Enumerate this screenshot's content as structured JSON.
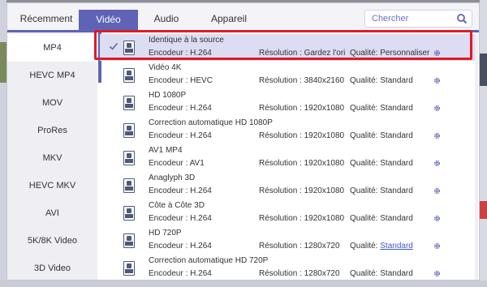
{
  "tabs": [
    {
      "label": "Récemment",
      "active": false
    },
    {
      "label": "Vidéo",
      "active": true
    },
    {
      "label": "Audio",
      "active": false
    },
    {
      "label": "Appareil",
      "active": false
    }
  ],
  "search": {
    "placeholder": "Chercher",
    "value": ""
  },
  "sidebar": {
    "items": [
      {
        "label": "MP4",
        "active": true
      },
      {
        "label": "HEVC MP4",
        "active": false
      },
      {
        "label": "MOV",
        "active": false
      },
      {
        "label": "ProRes",
        "active": false
      },
      {
        "label": "MKV",
        "active": false
      },
      {
        "label": "HEVC MKV",
        "active": false
      },
      {
        "label": "AVI",
        "active": false
      },
      {
        "label": "5K/8K Video",
        "active": false
      },
      {
        "label": "3D Video",
        "active": false
      }
    ]
  },
  "formats": [
    {
      "name": "Identique à la source",
      "encoder": "Encodeur : H.264",
      "resolution": "Résolution : Gardez l'original",
      "quality": "Qualité: Personnaliser",
      "quality_link": false,
      "selected": true,
      "icon": "file-copy-icon"
    },
    {
      "name": "Vidéo 4K",
      "encoder": "Encodeur : HEVC",
      "resolution": "Résolution : 3840x2160",
      "quality": "Qualité: Standard",
      "quality_link": false,
      "selected": false,
      "icon": "4k-icon"
    },
    {
      "name": "HD 1080P",
      "encoder": "Encodeur : H.264",
      "resolution": "Résolution : 1920x1080",
      "quality": "Qualité: Standard",
      "quality_link": false,
      "selected": false,
      "icon": "1080p-icon"
    },
    {
      "name": "Correction automatique HD 1080P",
      "encoder": "Encodeur : H.264",
      "resolution": "Résolution : 1920x1080",
      "quality": "Qualité: Standard",
      "quality_link": false,
      "selected": false,
      "icon": "1080p-icon"
    },
    {
      "name": "AV1 MP4",
      "encoder": "Encodeur : AV1",
      "resolution": "Résolution : 1920x1080",
      "quality": "Qualité: Standard",
      "quality_link": false,
      "selected": false,
      "icon": "av1-icon"
    },
    {
      "name": "Anaglyph 3D",
      "encoder": "Encodeur : H.264",
      "resolution": "Résolution : 1920x1080",
      "quality": "Qualité: Standard",
      "quality_link": false,
      "selected": false,
      "icon": "3d-icon"
    },
    {
      "name": "Côte à Côte 3D",
      "encoder": "Encodeur : H.264",
      "resolution": "Résolution : 1920x1080",
      "quality": "Qualité: Standard",
      "quality_link": false,
      "selected": false,
      "icon": "3d-icon"
    },
    {
      "name": "HD 720P",
      "encoder": "Encodeur : H.264",
      "resolution": "Résolution : 1280x720",
      "quality_prefix": "Qualité: ",
      "quality_value": "Standard",
      "quality": "Qualité: Standard",
      "quality_link": true,
      "selected": false,
      "icon": "720p-icon"
    },
    {
      "name": "Correction automatique HD 720P",
      "encoder": "Encodeur : H.264",
      "resolution": "Résolution : 1280x720",
      "quality": "Qualité: Standard",
      "quality_link": false,
      "selected": false,
      "icon": "720p-icon"
    }
  ],
  "colors": {
    "accent": "#5e63b6",
    "highlight_border": "#e01b24",
    "selected_row": "#dcdcf3",
    "link": "#3e59c8"
  }
}
